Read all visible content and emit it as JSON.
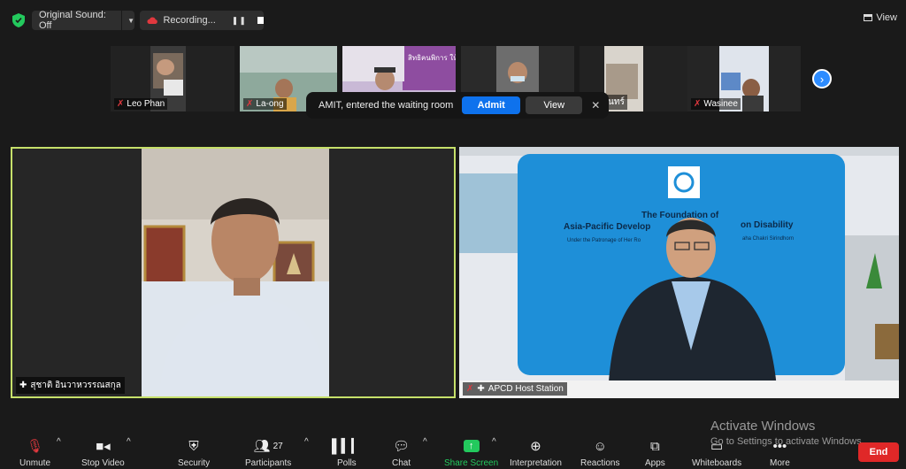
{
  "topbar": {
    "original_sound": "Original Sound: Off",
    "recording": "Recording...",
    "view": "View"
  },
  "thumbnails": [
    {
      "name": "Leo Phan",
      "muted": true
    },
    {
      "name": "La-ong",
      "muted": true
    },
    {
      "name": "",
      "muted": false
    },
    {
      "name": "",
      "muted": false
    },
    {
      "name": "ชนินทร์",
      "muted": true
    },
    {
      "name": "Wasinee",
      "muted": true
    }
  ],
  "waiting_room": {
    "message": "AMIT, entered the waiting room",
    "admit_label": "Admit",
    "view_label": "View"
  },
  "tiles": {
    "left_name": "สุชาติ อินวาหวรรณสกุล",
    "right_name": "APCD Host Station",
    "right_backdrop_line1": "The Foundation of",
    "right_backdrop_line2": "Asia-Pacific Develop",
    "right_backdrop_line2b": "on Disability",
    "right_backdrop_line3": "Under the Patronage of Her Ro",
    "right_backdrop_line3b": "aha Chakri Sirindhorn",
    "left_poster_text": "สิทธิคนพิการ ให้เป็นจริง"
  },
  "toolbar": {
    "unmute": "Unmute",
    "stop_video": "Stop Video",
    "security": "Security",
    "participants": "Participants",
    "participants_count": "27",
    "polls": "Polls",
    "chat": "Chat",
    "share_screen": "Share Screen",
    "interpretation": "Interpretation",
    "reactions": "Reactions",
    "apps": "Apps",
    "whiteboards": "Whiteboards",
    "more": "More",
    "end": "End"
  },
  "watermark": {
    "line1": "Activate Windows",
    "line2": "Go to Settings to activate Windows."
  },
  "colors": {
    "active_speaker_border": "#c6e06a",
    "admit_blue": "#0e72ed",
    "share_green": "#23c95d",
    "end_red": "#e02828"
  }
}
